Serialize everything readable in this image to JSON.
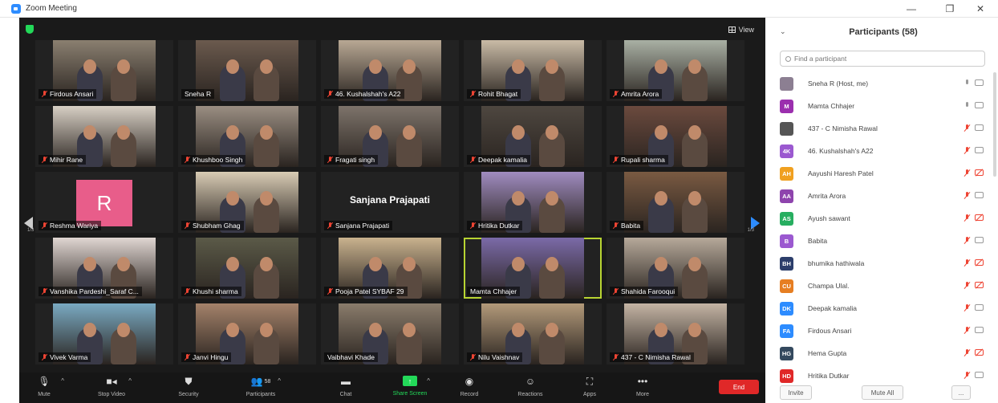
{
  "window": {
    "title": "Zoom Meeting",
    "controls": [
      "—",
      "❐",
      "✕"
    ]
  },
  "view_label": "View",
  "tiles": [
    {
      "name": "Firdous Ansari",
      "bg": "#8a7f70",
      "muted": true
    },
    {
      "name": "Sneha R",
      "bg": "#6b5a4e",
      "muted": false
    },
    {
      "name": "46. Kushalshah's A22",
      "bg": "#b8a894",
      "muted": true
    },
    {
      "name": "Rohit Bhagat",
      "bg": "#c9bba6",
      "muted": true
    },
    {
      "name": "Amrita Arora",
      "bg": "#a9b0a4",
      "muted": true
    },
    {
      "name": "Mihir Rane",
      "bg": "#d7cfc4",
      "muted": true
    },
    {
      "name": "Khushboo Singh",
      "bg": "#9a8e82",
      "muted": true
    },
    {
      "name": "Fragati singh",
      "bg": "#7d736a",
      "muted": true
    },
    {
      "name": "Deepak kamalia",
      "bg": "#4e4740",
      "muted": true
    },
    {
      "name": "Rupali sharma",
      "bg": "#6b4a3e",
      "muted": true
    },
    {
      "name": "Reshma Wariya",
      "bg": "#1a1a1a",
      "muted": true,
      "initial": "R"
    },
    {
      "name": "Shubham Ghag",
      "bg": "#d8cbb4",
      "muted": true
    },
    {
      "name": "Sanjana Prajapati",
      "bg": "#1a1a1a",
      "muted": true,
      "bigname": "Sanjana Prajapati"
    },
    {
      "name": "Hritika Dutkar",
      "bg": "#a08cc0",
      "muted": true
    },
    {
      "name": "Babita",
      "bg": "#7a5a42",
      "muted": true
    },
    {
      "name": "Vanshika Pardeshi_Saraf C...",
      "bg": "#e0d6d2",
      "muted": true
    },
    {
      "name": "Khushi sharma",
      "bg": "#5b5a48",
      "muted": true
    },
    {
      "name": "Pooja Patel SYBAF 29",
      "bg": "#c9b28e",
      "muted": true
    },
    {
      "name": "Mamta Chhajer",
      "bg": "#7b6aa8",
      "muted": false,
      "active": true
    },
    {
      "name": "Shahida Farooqui",
      "bg": "#b6a99a",
      "muted": true
    },
    {
      "name": "Vivek Varma",
      "bg": "#7aaac2",
      "muted": true
    },
    {
      "name": "Janvi Hingu",
      "bg": "#a4826a",
      "muted": true
    },
    {
      "name": "Vaibhavi Khade",
      "bg": "#8a7c6c",
      "muted": false
    },
    {
      "name": "Nilu Vaishnav",
      "bg": "#b39a7a",
      "muted": true
    },
    {
      "name": "437 - C Nimisha Rawal",
      "bg": "#c4b4a4",
      "muted": true
    }
  ],
  "pager": {
    "left": "1/3",
    "right": "1/3"
  },
  "toolbar": {
    "mute": "Mute",
    "stop_video": "Stop Video",
    "security": "Security",
    "participants": "Participants",
    "participants_count": "58",
    "chat": "Chat",
    "share_screen": "Share Screen",
    "record": "Record",
    "reactions": "Reactions",
    "apps": "Apps",
    "more": "More",
    "end": "End"
  },
  "panel": {
    "title": "Participants (58)",
    "search_placeholder": "Find a participant",
    "participants": [
      {
        "name": "Sneha R (Host, me)",
        "initials": "",
        "color": "#8c7f92",
        "mic": "on",
        "cam": "on"
      },
      {
        "name": "Mamta Chhajer",
        "initials": "M",
        "color": "#9b2fae",
        "mic": "on",
        "cam": "on"
      },
      {
        "name": "437 - C Nimisha Rawal",
        "initials": "",
        "color": "#555555",
        "mic": "off",
        "cam": "on"
      },
      {
        "name": "46. Kushalshah's A22",
        "initials": "4K",
        "color": "#9b59d0",
        "mic": "off",
        "cam": "on"
      },
      {
        "name": "Aayushi Haresh Patel",
        "initials": "AH",
        "color": "#f0a020",
        "mic": "off",
        "cam": "off"
      },
      {
        "name": "Amrita Arora",
        "initials": "AA",
        "color": "#8e44ad",
        "mic": "off",
        "cam": "on"
      },
      {
        "name": "Ayush sawant",
        "initials": "AS",
        "color": "#27ae60",
        "mic": "off",
        "cam": "off"
      },
      {
        "name": "Babita",
        "initials": "B",
        "color": "#9b59d0",
        "mic": "off",
        "cam": "on"
      },
      {
        "name": "bhumika hathiwala",
        "initials": "BH",
        "color": "#2c3e6b",
        "mic": "off",
        "cam": "off"
      },
      {
        "name": "Champa Ulal.",
        "initials": "CU",
        "color": "#e67e22",
        "mic": "off",
        "cam": "off"
      },
      {
        "name": "Deepak kamalia",
        "initials": "DK",
        "color": "#2d8cff",
        "mic": "off",
        "cam": "on"
      },
      {
        "name": "Firdous Ansari",
        "initials": "FA",
        "color": "#2d8cff",
        "mic": "off",
        "cam": "on"
      },
      {
        "name": "Hema Gupta",
        "initials": "HG",
        "color": "#34495e",
        "mic": "off",
        "cam": "off"
      },
      {
        "name": "Hritika Dutkar",
        "initials": "HD",
        "color": "#e02828",
        "mic": "off",
        "cam": "on"
      }
    ],
    "invite": "Invite",
    "mute_all": "Mute All",
    "more": "..."
  }
}
